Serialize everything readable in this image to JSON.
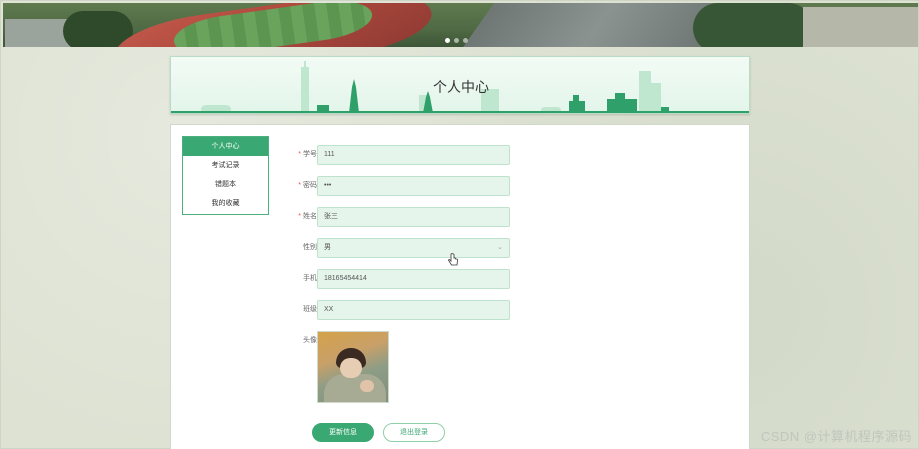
{
  "banner": {
    "slides": 3,
    "active_slide": 1
  },
  "header": {
    "title": "个人中心"
  },
  "menu": {
    "items": [
      {
        "label": "个人中心",
        "active": true
      },
      {
        "label": "考试记录",
        "active": false
      },
      {
        "label": "错题本",
        "active": false
      },
      {
        "label": "我的收藏",
        "active": false
      }
    ]
  },
  "form": {
    "student_id": {
      "label": "学号",
      "required": true,
      "value": "111"
    },
    "password": {
      "label": "密码",
      "required": true,
      "value": "•••"
    },
    "name": {
      "label": "姓名",
      "required": true,
      "value": "张三"
    },
    "gender": {
      "label": "性别",
      "required": false,
      "value": "男"
    },
    "phone": {
      "label": "手机",
      "required": false,
      "value": "18165454414"
    },
    "class": {
      "label": "班级",
      "required": false,
      "value": "XX"
    },
    "avatar": {
      "label": "头像"
    }
  },
  "buttons": {
    "update": "更新信息",
    "logout": "退出登录"
  },
  "watermark": "CSDN @计算机程序源码",
  "colors": {
    "accent": "#3aa872",
    "input_bg": "#e6f5ec",
    "required": "#e05252"
  }
}
